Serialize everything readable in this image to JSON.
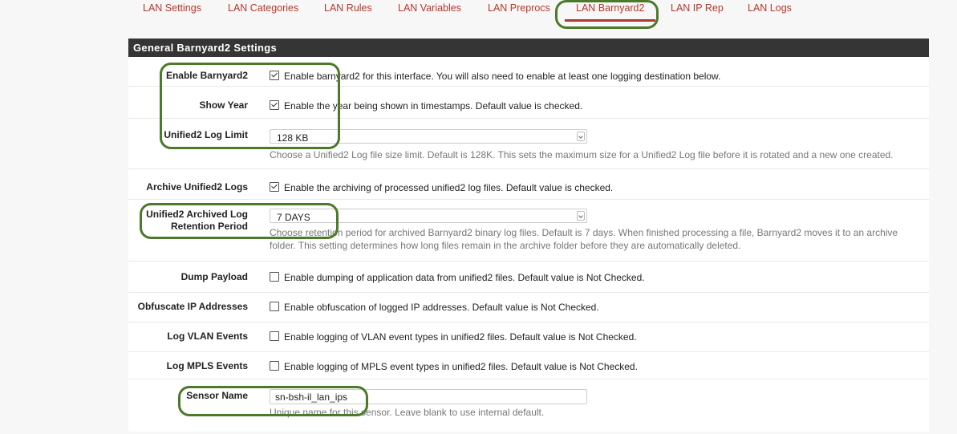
{
  "tabs": [
    {
      "label": "LAN Settings"
    },
    {
      "label": "LAN Categories"
    },
    {
      "label": "LAN Rules"
    },
    {
      "label": "LAN Variables"
    },
    {
      "label": "LAN Preprocs"
    },
    {
      "label": "LAN Barnyard2"
    },
    {
      "label": "LAN IP Rep"
    },
    {
      "label": "LAN Logs"
    }
  ],
  "active_tab": "LAN Barnyard2",
  "panel": {
    "title": "General Barnyard2 Settings"
  },
  "fields": {
    "enable_barnyard2": {
      "label": "Enable Barnyard2",
      "checked": true,
      "desc": "Enable barnyard2 for this interface. You will also need to enable at least one logging destination below."
    },
    "show_year": {
      "label": "Show Year",
      "checked": true,
      "desc": "Enable the year being shown in timestamps. Default value is checked."
    },
    "unified2_log_limit": {
      "label": "Unified2 Log Limit",
      "value": "128 KB",
      "help": "Choose a Unified2 Log file size limit. Default is 128K. This sets the maximum size for a Unified2 Log file before it is rotated and a new one created."
    },
    "archive_unified2_logs": {
      "label": "Archive Unified2 Logs",
      "checked": true,
      "desc": "Enable the archiving of processed unified2 log files. Default value is checked."
    },
    "archived_log_retention": {
      "label_line1": "Unified2 Archived Log",
      "label_line2": "Retention Period",
      "value": "7 DAYS",
      "help_line1": "Choose retention period for archived Barnyard2 binary log files. Default is 7 days. When finished processing a file, Barnyard2 moves it to an archive",
      "help_line2": "folder. This setting determines how long files remain in the archive folder before they are automatically deleted."
    },
    "dump_payload": {
      "label": "Dump Payload",
      "checked": false,
      "desc": "Enable dumping of application data from unified2 files. Default value is Not Checked."
    },
    "obfuscate_ip": {
      "label": "Obfuscate IP Addresses",
      "checked": false,
      "desc": "Enable obfuscation of logged IP addresses. Default value is Not Checked."
    },
    "log_vlan_events": {
      "label": "Log VLAN Events",
      "checked": false,
      "desc": "Enable logging of VLAN event types in unified2 files. Default value is Not Checked."
    },
    "log_mpls_events": {
      "label": "Log MPLS Events",
      "checked": false,
      "desc": "Enable logging of MPLS event types in unified2 files. Default value is Not Checked."
    },
    "sensor_name": {
      "label": "Sensor Name",
      "value": "sn-bsh-il_lan_ips",
      "help": "Unique name for this sensor. Leave blank to use internal default."
    }
  },
  "colors": {
    "tab_link": "#b03a2e",
    "panel_heading_bg": "#353535",
    "highlight_ring": "#4a7a2a"
  }
}
